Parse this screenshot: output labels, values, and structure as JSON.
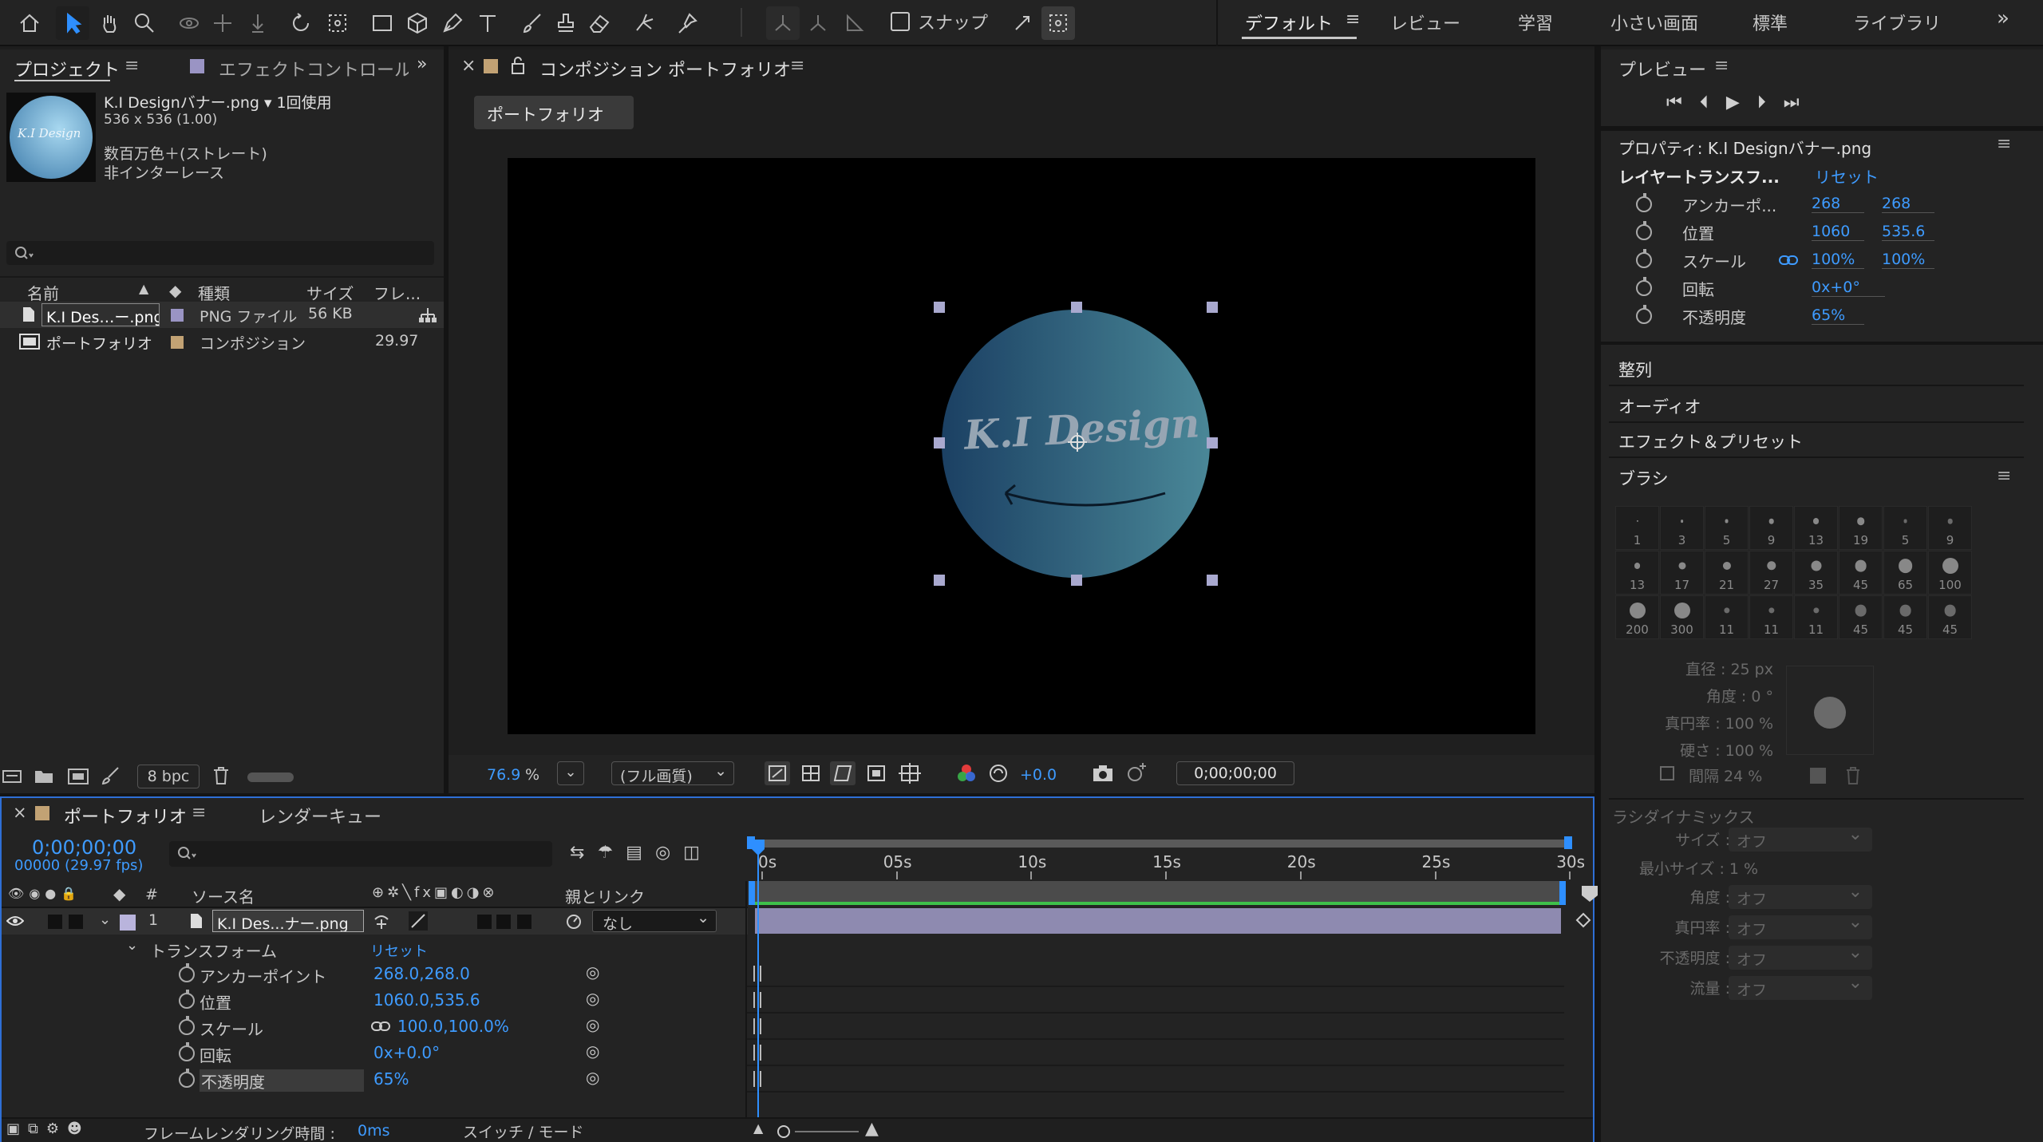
{
  "workspace": {
    "snap_label": "スナップ",
    "items": [
      "デフォルト",
      "レビュー",
      "学習",
      "小さい画面",
      "標準",
      "ライブラリ"
    ],
    "more": "»",
    "menu_icon": "≡"
  },
  "project": {
    "tab_project": "プロジェクト",
    "tab_effects": "エフェクトコントロール",
    "expand": "»",
    "file_name": "K.I Designバナー.png ▾ 1回使用",
    "dimensions": "536 x 536 (1.00)",
    "color_info": "数百万色＋(ストレート)",
    "interlace": "非インターレース",
    "thumb_text": "K.I Design",
    "search_placeholder": "",
    "col_name": "名前",
    "col_type": "種類",
    "col_size": "サイズ",
    "col_frame": "フレ...",
    "items": [
      {
        "name": "K.I Des…ー.png",
        "type": "PNG ファイル",
        "size": "56 KB",
        "frame": ""
      },
      {
        "name": "ポートフォリオ",
        "type": "コンポジション",
        "size": "",
        "frame": "29.97"
      }
    ],
    "bpc": "8 bpc"
  },
  "comp": {
    "close": "×",
    "tab_label": "コンポジション ポートフォリオ",
    "breadcrumb": "ポートフォリオ",
    "art_text": "K.I Design",
    "zoom": "76.9",
    "zoom_unit": "%",
    "quality": "(フル画質)",
    "exposure": "+0.0",
    "timecode": "0;00;00;00"
  },
  "right": {
    "preview_title": "プレビュー",
    "properties_title": "プロパティ: K.I Designバナー.png",
    "transform_header": "レイヤートランスフ...",
    "reset": "リセット",
    "props": [
      {
        "label": "アンカーポ...",
        "v1": "268",
        "v2": "268"
      },
      {
        "label": "位置",
        "v1": "1060",
        "v2": "535.6"
      },
      {
        "label": "スケール",
        "v1": "100%",
        "v2": "100%"
      },
      {
        "label": "回転",
        "v1": "0x+0°",
        "v2": ""
      },
      {
        "label": "不透明度",
        "v1": "65%",
        "v2": ""
      }
    ],
    "sections": [
      "整列",
      "オーディオ",
      "エフェクト＆プリセット"
    ],
    "brush_title": "ブラシ",
    "brushes": [
      "1",
      "3",
      "5",
      "9",
      "13",
      "19",
      "5",
      "9",
      "13",
      "17",
      "21",
      "27",
      "35",
      "45",
      "65",
      "100",
      "200",
      "300",
      "11",
      "11",
      "11",
      "45",
      "45",
      "45"
    ],
    "brush_diameter": "直径 : 25 px",
    "brush_angle": "角度 : 0 °",
    "brush_roundness": "真円率 : 100 %",
    "brush_hardness": "硬さ : 100 %",
    "brush_spacing": "間隔 24 %",
    "dynamics_title": "ラシダイナミックス",
    "dyn_labels": [
      "サイズ :",
      "最小サイズ : 1 %",
      "角度 :",
      "真円率 :",
      "不透明度 :",
      "流量 :"
    ],
    "dyn_off": "オフ"
  },
  "timeline": {
    "close": "×",
    "tab_comp": "ポートフォリオ",
    "tab_render": "レンダーキュー",
    "timecode": "0;00;00;00",
    "fps": "00000 (29.97 fps)",
    "col_source": "ソース名",
    "col_parent": "親とリンク",
    "layer_num": "1",
    "layer_name": "K.I Des...ナー.png",
    "parent_value": "なし",
    "transform_label": "トランスフォーム",
    "reset": "リセット",
    "props": [
      {
        "label": "アンカーポイント",
        "value": "268.0,268.0"
      },
      {
        "label": "位置",
        "value": "1060.0,535.6"
      },
      {
        "label": "スケール",
        "value": "100.0,100.0%"
      },
      {
        "label": "回転",
        "value": "0x+0.0°"
      },
      {
        "label": "不透明度",
        "value": "65%"
      }
    ],
    "ticks": [
      "0s",
      "05s",
      "10s",
      "15s",
      "20s",
      "25s",
      "30s"
    ],
    "render_time_label": "フレームレンダリング時間 : ",
    "render_time_value": "0ms",
    "switch_mode": "スイッチ / モード"
  },
  "colors": {
    "accent": "#2e8fff",
    "timecode": "#3e9bff",
    "layer_bar": "#8e8ab0",
    "work_area": "#3ec04a",
    "art_grad_from": "#1d4469",
    "art_grad_to": "#4e8fa0"
  }
}
